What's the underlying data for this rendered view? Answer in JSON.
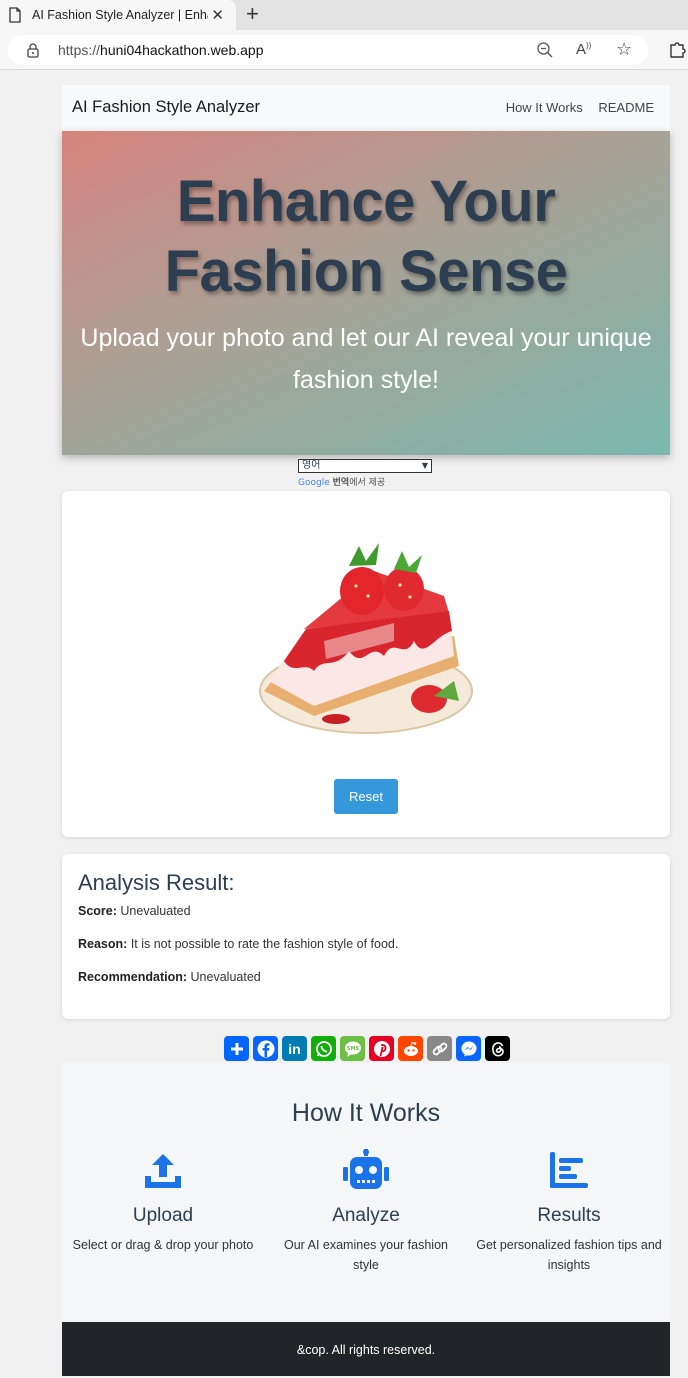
{
  "browser": {
    "tab_title": "AI Fashion Style Analyzer | Enhance",
    "url_scheme": "https://",
    "url_host": "huni04hackathon.web.app"
  },
  "nav": {
    "brand": "AI Fashion Style Analyzer",
    "links": [
      "How It Works",
      "README"
    ]
  },
  "hero": {
    "title": "Enhance Your Fashion Sense",
    "subtitle": "Upload your photo and let our AI reveal your unique fashion style!"
  },
  "translate": {
    "selected_language": "영어",
    "powered_prefix": "Google",
    "powered_bold": "번역",
    "powered_suffix": "에서 제공"
  },
  "upload": {
    "image_alt": "strawberry cheesecake slice",
    "reset_label": "Reset"
  },
  "result": {
    "heading": "Analysis Result:",
    "score_label": "Score:",
    "score_value": "Unevaluated",
    "reason_label": "Reason:",
    "reason_value": "It is not possible to rate the fashion style of food.",
    "recommendation_label": "Recommendation:",
    "recommendation_value": "Unevaluated"
  },
  "share": [
    {
      "name": "share-icon",
      "color": "#0166ff"
    },
    {
      "name": "facebook-icon",
      "color": "#0866ff"
    },
    {
      "name": "linkedin-icon",
      "color": "#007bb5"
    },
    {
      "name": "whatsapp-icon",
      "color": "#12af0a"
    },
    {
      "name": "sms-icon",
      "color": "#6cbe45"
    },
    {
      "name": "pinterest-icon",
      "color": "#e60023"
    },
    {
      "name": "reddit-icon",
      "color": "#ff4500"
    },
    {
      "name": "copy-link-icon",
      "color": "#888888"
    },
    {
      "name": "messenger-icon",
      "color": "#0866ff"
    },
    {
      "name": "threads-icon",
      "color": "#000000"
    }
  ],
  "how": {
    "heading": "How It Works",
    "steps": [
      {
        "title": "Upload",
        "desc": "Select or drag & drop your photo",
        "icon": "upload-icon"
      },
      {
        "title": "Analyze",
        "desc": "Our AI examines your fashion style",
        "icon": "robot-icon"
      },
      {
        "title": "Results",
        "desc": "Get personalized fashion tips and insights",
        "icon": "chart-icon"
      }
    ]
  },
  "footer": {
    "text": "&cop. All rights reserved."
  },
  "colors": {
    "accent": "#3498db",
    "icon_blue": "#1a73e8",
    "text_dark": "#2c3e50",
    "footer_bg": "#212529"
  }
}
